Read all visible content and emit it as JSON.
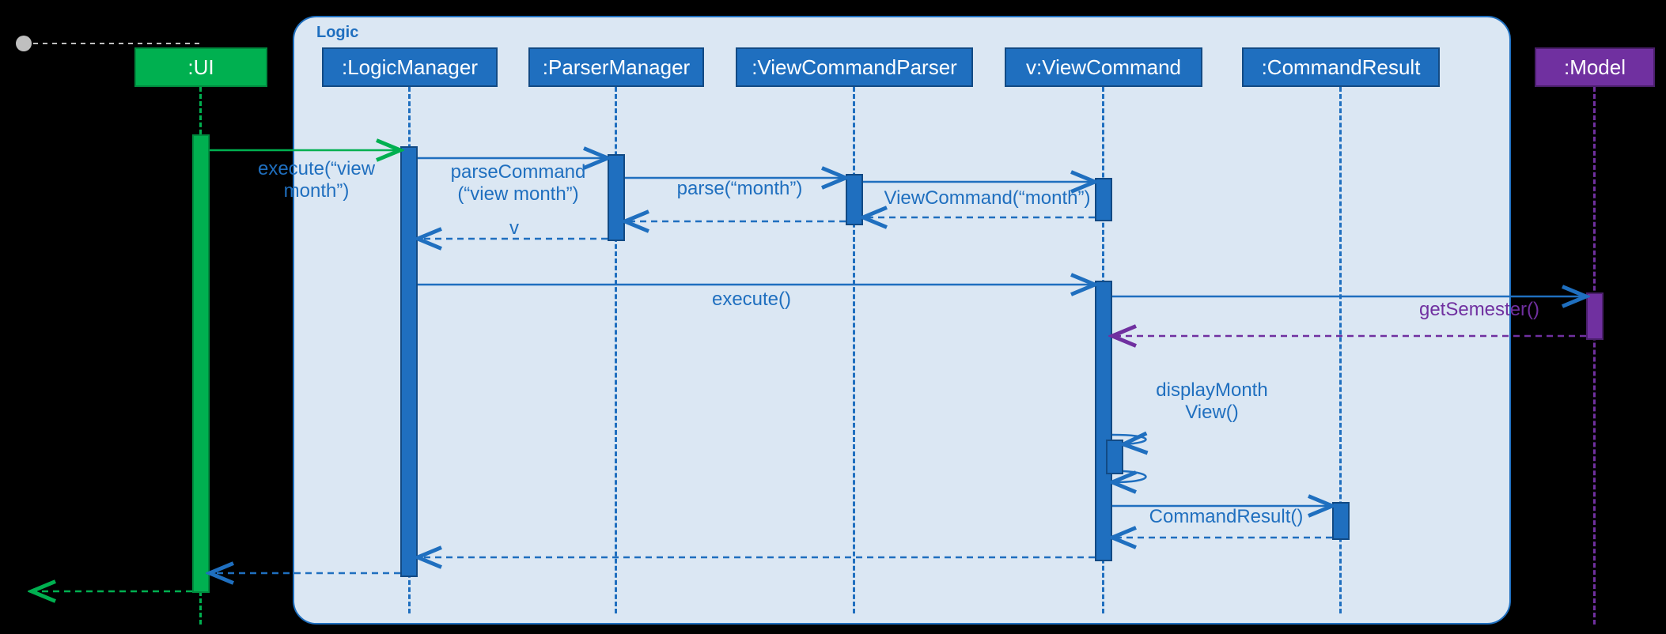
{
  "frame_label": "Logic",
  "heads": {
    "ui": ":UI",
    "logic_manager": ":LogicManager",
    "parser_manager": ":ParserManager",
    "view_command_parser": ":ViewCommandParser",
    "view_command": "v:ViewCommand",
    "command_result": ":CommandResult",
    "model": ":Model"
  },
  "messages": {
    "exec_view_month_1": "execute(“view",
    "exec_view_month_2": "month”)",
    "parse_command_1": "parseCommand",
    "parse_command_2": "(“view month”)",
    "parse_month": "parse(“month”)",
    "view_command_ctor": "ViewCommand(“month”)",
    "return_v": "v",
    "execute": "execute()",
    "get_semester": "getSemester()",
    "display_month_1": "displayMonth",
    "display_month_2": "View()",
    "command_result_ctor": "CommandResult()"
  }
}
